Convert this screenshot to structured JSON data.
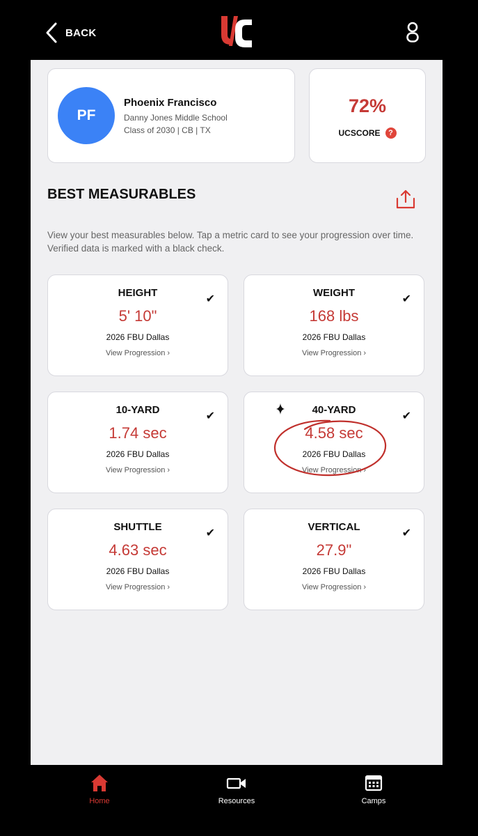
{
  "header": {
    "back_label": "BACK",
    "logo_text": "UC",
    "accent": "#d93a33"
  },
  "player": {
    "initials": "PF",
    "name": "Phoenix Francisco",
    "school": "Danny Jones Middle School",
    "details": "Class of 2030 | CB | TX",
    "avatar_color": "#3b82f6"
  },
  "score": {
    "value": "72%",
    "label": "UCSCORE",
    "help": "?"
  },
  "measurables": {
    "title": "BEST MEASURABLES",
    "description": "View your best measurables below. Tap a metric card to see your progression over time. Verified data is marked with a black check.",
    "cards": [
      {
        "title": "HEIGHT",
        "value": "5' 10\"",
        "event": "2026 FBU Dallas",
        "link": "View Progression ›",
        "verified": "✔"
      },
      {
        "title": "WEIGHT",
        "value": "168 lbs",
        "event": "2026 FBU Dallas",
        "link": "View Progression ›",
        "verified": "✔"
      },
      {
        "title": "10-YARD",
        "value": "1.74 sec",
        "event": "2026 FBU Dallas",
        "link": "View Progression ›",
        "verified": "✔"
      },
      {
        "title": "40-YARD",
        "value": "4.58 sec",
        "event": "2026 FBU Dallas",
        "link": "View Progression ›",
        "verified": "✔"
      },
      {
        "title": "SHUTTLE",
        "value": "4.63 sec",
        "event": "2026 FBU Dallas",
        "link": "View Progression ›",
        "verified": "✔"
      },
      {
        "title": "VERTICAL",
        "value": "27.9\"",
        "event": "2026 FBU Dallas",
        "link": "View Progression ›",
        "verified": "✔"
      }
    ]
  },
  "nav": {
    "items": [
      {
        "label": "Home",
        "icon": "home-icon",
        "active": true
      },
      {
        "label": "Resources",
        "icon": "video-camera-icon",
        "active": false
      },
      {
        "label": "Camps",
        "icon": "calendar-icon",
        "active": false
      }
    ]
  }
}
